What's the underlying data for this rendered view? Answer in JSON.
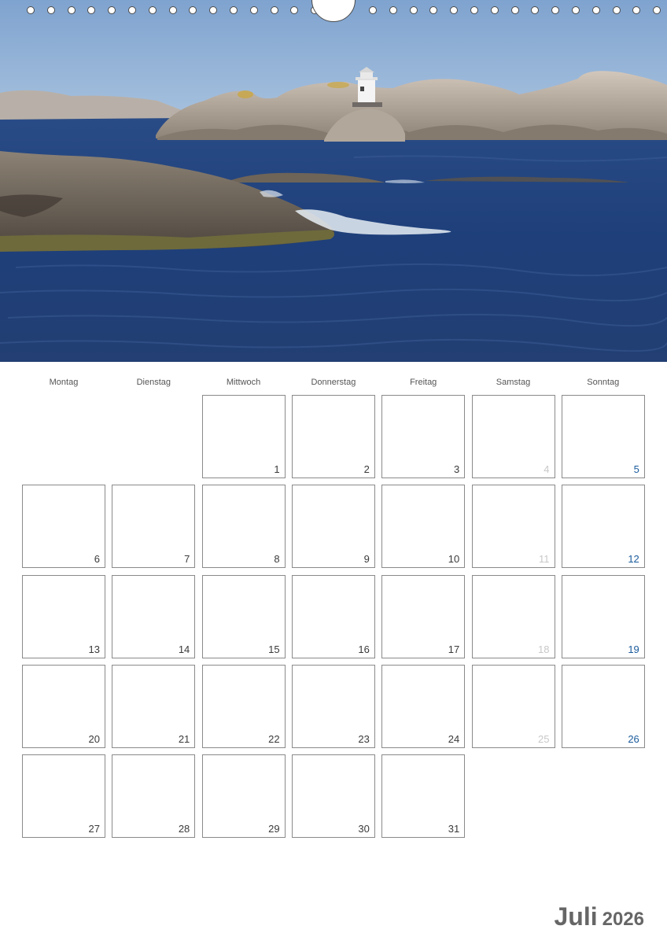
{
  "calendar": {
    "month": "Juli",
    "year": "2026",
    "weekdays": [
      "Montag",
      "Dienstag",
      "Mittwoch",
      "Donnerstag",
      "Freitag",
      "Samstag",
      "Sonntag"
    ],
    "first_weekday_index": 2,
    "days_in_month": 31
  },
  "photo": {
    "subject": "lighthouse-on-granite-rocks",
    "colors": {
      "sky": "#8fb0d4",
      "sea": "#1f3f78",
      "rock": "#b9aea3"
    }
  },
  "colors": {
    "saturday": "#c8c8c8",
    "sunday": "#1a5b9c",
    "weekday_number": "#3a3a3a",
    "title": "#666666"
  }
}
